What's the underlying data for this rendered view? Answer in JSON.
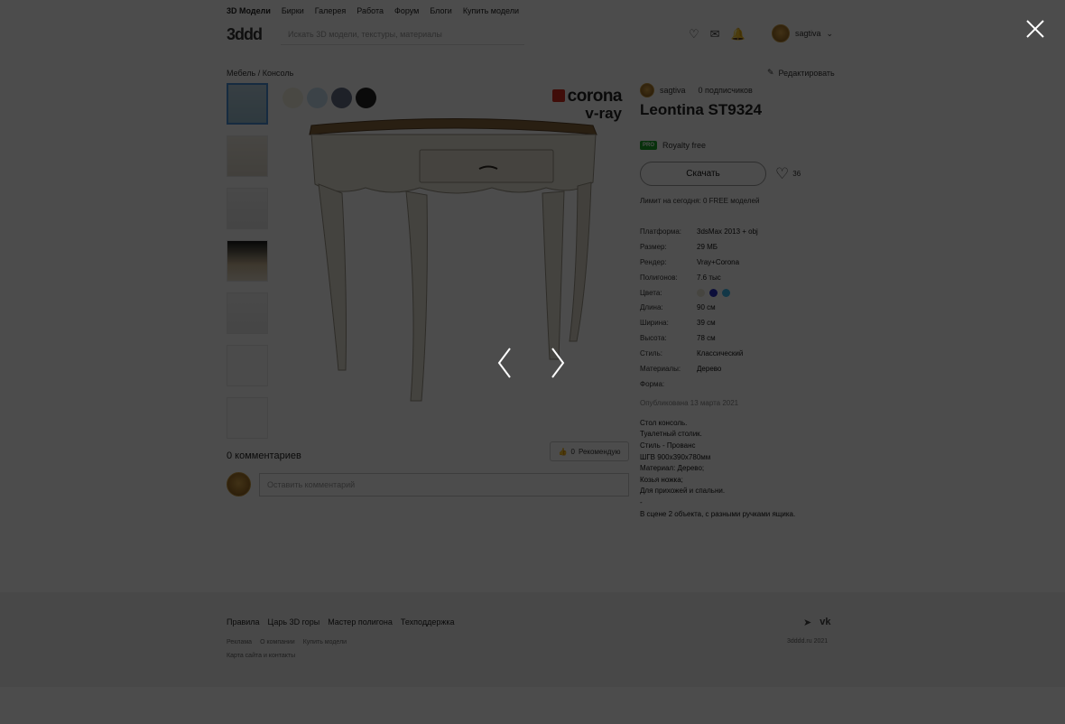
{
  "nav": {
    "items": [
      "3D Модели",
      "Бирки",
      "Галерея",
      "Работа",
      "Форум",
      "Блоги",
      "Купить модели"
    ]
  },
  "header": {
    "logo": "3ddd",
    "search_placeholder": "Искать 3D модели, текстуры, материалы",
    "user_name": "sagtiva"
  },
  "breadcrumb": "Мебель / Консоль",
  "edit_label": "Редактировать",
  "swatch_colors": [
    "#f4f0e0",
    "#c9e2f2",
    "#666f86",
    "#242424"
  ],
  "renderer_labels": [
    "corona",
    "v-ray"
  ],
  "comments": {
    "count_label": "0 комментариев",
    "recommend_label": "Рекомендую",
    "recommend_count": "0",
    "input_placeholder": "Оставить комментарий"
  },
  "model": {
    "author": "sagtiva",
    "followers": "0 подписчиков",
    "title": "Leontina ST9324",
    "pro_badge": "PRO",
    "license": "Royalty free",
    "download_label": "Скачать",
    "likes": "36",
    "limit_text": "Лимит на сегодня: 0 FREE моделей"
  },
  "props": [
    {
      "k": "Платформа:",
      "v": "3dsMax 2013 + obj"
    },
    {
      "k": "Размер:",
      "v": "29 МБ"
    },
    {
      "k": "Рендер:",
      "v": "Vray+Corona"
    },
    {
      "k": "Полигонов:",
      "v": "7.6 тыс"
    },
    {
      "k": "Цвета:",
      "v": ""
    },
    {
      "k": "Длина:",
      "v": "90 см"
    },
    {
      "k": "Ширина:",
      "v": "39 см"
    },
    {
      "k": "Высота:",
      "v": "78 см"
    },
    {
      "k": "Стиль:",
      "v": "Классический"
    },
    {
      "k": "Материалы:",
      "v": "Дерево"
    },
    {
      "k": "Форма:",
      "v": ""
    }
  ],
  "prop_colors": [
    "#ece7d6",
    "#2a2fc4",
    "#3db8ee"
  ],
  "published": "Опубликована 13 марта 2021",
  "description": [
    "Стол консоль.",
    "Туалетный столик.",
    "Стиль - Прованс",
    "ШГВ 900x390x780мм",
    "Материал: Дерево;",
    "Козья ножка;",
    "Для прихожей и спальни.",
    "-",
    "В сцене 2 объекта, с разными ручками ящика."
  ],
  "footer": {
    "links": [
      "Правила",
      "Царь 3D горы",
      "Мастер полигона",
      "Техподдержка"
    ],
    "sub_links": [
      "Реклама",
      "О компании",
      "Купить модели"
    ],
    "sub2": "Карта сайта и контакты",
    "copyright": "3dddd.ru 2021",
    "social": [
      "telegram-icon",
      "vk-icon"
    ]
  }
}
